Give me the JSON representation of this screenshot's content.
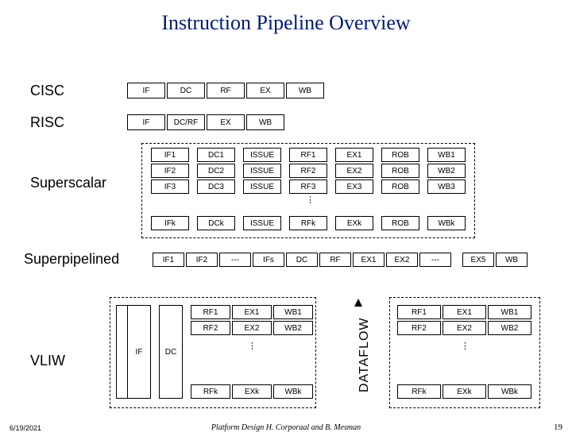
{
  "title": "Instruction Pipeline Overview",
  "labels": {
    "cisc": "CISC",
    "risc": "RISC",
    "superscalar": "Superscalar",
    "superpipelined": "Superpipelined",
    "vliw": "VLIW",
    "dataflow": "DATAFLOW"
  },
  "cisc": [
    "IF",
    "DC",
    "RF",
    "EX",
    "WB"
  ],
  "risc": [
    "IF",
    "DC/RF",
    "EX",
    "WB"
  ],
  "superscalar": {
    "rows": [
      [
        "IF1",
        "DC1",
        "ISSUE",
        "RF1",
        "EX1",
        "ROB",
        "WB1"
      ],
      [
        "IF2",
        "DC2",
        "ISSUE",
        "RF2",
        "EX2",
        "ROB",
        "WB2"
      ],
      [
        "IF3",
        "DC3",
        "ISSUE",
        "RF3",
        "EX3",
        "ROB",
        "WB3"
      ]
    ],
    "last": [
      "IFk",
      "DCk",
      "ISSUE",
      "RFk",
      "EXk",
      "ROB",
      "WBk"
    ]
  },
  "superpipe": [
    "IF1",
    "IF2",
    "---",
    "IFs",
    "DC",
    "RF",
    "EX1",
    "EX2",
    "---",
    "EX5",
    "WB"
  ],
  "vliw": {
    "left": {
      "if": "IF",
      "dc": "DC"
    },
    "rows": [
      [
        "RF1",
        "EX1",
        "WB1"
      ],
      [
        "RF2",
        "EX2",
        "WB2"
      ]
    ],
    "last": [
      "RFk",
      "EXk",
      "WBk"
    ],
    "rows_right": [
      [
        "RF1",
        "EX1",
        "WB1"
      ],
      [
        "RF2",
        "EX2",
        "WB2"
      ]
    ],
    "last_right": [
      "RFk",
      "EXk",
      "WBk"
    ]
  },
  "footer": {
    "date": "6/19/2021",
    "center": "Platform Design     H. Corporaal and B. Mesman",
    "page": "19"
  }
}
